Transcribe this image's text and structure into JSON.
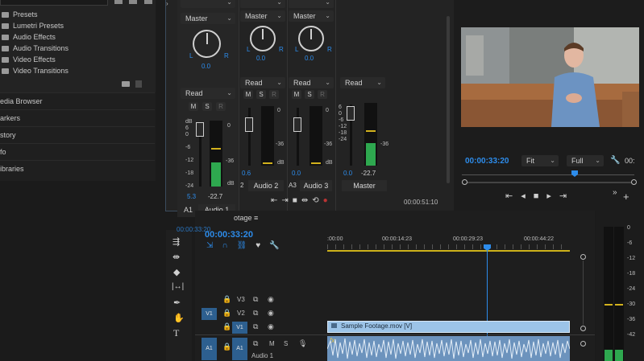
{
  "effects_panel": {
    "items": [
      "Presets",
      "Lumetri Presets",
      "Audio Effects",
      "Audio Transitions",
      "Video Effects",
      "Video Transitions"
    ]
  },
  "side_panels": [
    "edia Browser",
    "arkers",
    "story",
    "fo",
    "ibraries"
  ],
  "mixer": {
    "channels": [
      {
        "route": "Master",
        "pan": "0.0",
        "mode": "Read",
        "mute": "M",
        "solo": "S",
        "rec": "R",
        "fader_value": "5.3",
        "meter_value": "-22.7",
        "track_id": "A1",
        "name": "Audio 1"
      },
      {
        "route": "Master",
        "pan": "0.0",
        "mode": "Read",
        "mute": "M",
        "solo": "S",
        "rec": "R",
        "fader_value": "0.6",
        "meter_value": "",
        "track_id": "2",
        "name": "Audio 2"
      },
      {
        "route": "Master",
        "pan": "0.0",
        "mode": "Read",
        "mute": "M",
        "solo": "S",
        "rec": "R",
        "fader_value": "0.0",
        "meter_value": "",
        "track_id": "A3",
        "name": "Audio 3"
      },
      {
        "route": "",
        "pan": "",
        "mode": "Read",
        "mute": "",
        "solo": "",
        "rec": "",
        "fader_value": "0.0",
        "meter_value": "-22.7",
        "track_id": "",
        "name": "Master"
      }
    ],
    "fader_scale": [
      "dB",
      "6",
      "0",
      "-6",
      "-12",
      "-18",
      "-24"
    ],
    "meter_scale": [
      "0",
      "-36",
      "dB"
    ],
    "meter_scale_master": [
      "0",
      "-6",
      "-12",
      "-18",
      "-24",
      "-30",
      "-36",
      "-42"
    ],
    "timecode": "00:00:51:10",
    "timecode_behind": "00:00:33:20"
  },
  "program_monitor": {
    "timecode": "00:00:33:20",
    "fit": "Fit",
    "quality": "Full",
    "end_timecode": "00:"
  },
  "timeline": {
    "title": "otage",
    "timecode": "00:00:33:20",
    "ruler": [
      ":00:00",
      "00:00:14:23",
      "00:00:29:23",
      "00:00:44:22"
    ],
    "tracks": [
      {
        "target": "",
        "id": "V3"
      },
      {
        "target": "V1",
        "id": "V2"
      },
      {
        "target": "",
        "id": "V1"
      },
      {
        "target": "A1",
        "id": "A1",
        "name": "Audio 1",
        "mute": "M",
        "solo": "S"
      }
    ],
    "video_clip": "Sample Footage.mov [V]",
    "audio_clip_fx": "fx"
  },
  "right_meter": {
    "scale": [
      "0",
      "-6",
      "-12",
      "-18",
      "-24",
      "-30",
      "-36",
      "-42"
    ]
  },
  "colors": {
    "accent": "#2d8ceb",
    "meter_green": "#2ea84f",
    "playhead": "#2d8ceb",
    "clip_video": "#9cc4e8",
    "clip_audio": "#6c93bd"
  }
}
